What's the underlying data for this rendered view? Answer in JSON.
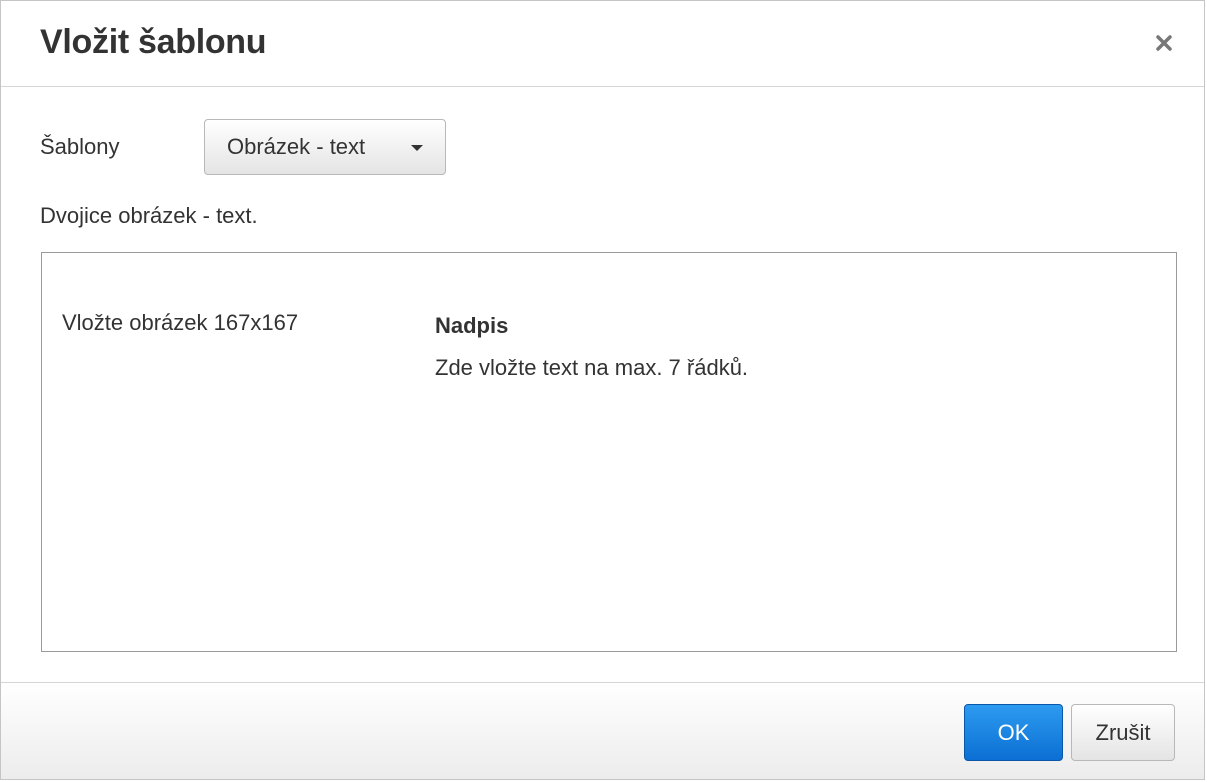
{
  "dialog": {
    "title": "Vložit šablonu",
    "close_icon": "close-icon"
  },
  "templates": {
    "label": "Šablony",
    "selected": "Obrázek - text",
    "description": "Dvojice obrázek - text."
  },
  "preview": {
    "image_placeholder": "Vložte obrázek 167x167",
    "heading": "Nadpis",
    "text": "Zde vložte text na max. 7 řádků."
  },
  "footer": {
    "ok_label": "OK",
    "cancel_label": "Zrušit"
  },
  "colors": {
    "primary_button": "#0b6fd3",
    "text": "#333333",
    "border": "#d5d5d5"
  }
}
